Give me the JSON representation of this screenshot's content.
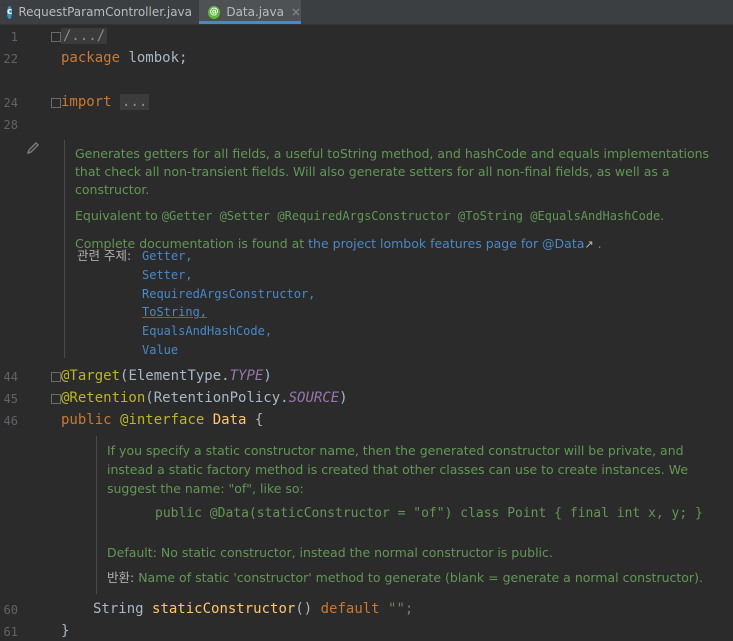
{
  "tabs": [
    {
      "label": "RequestParamController.java",
      "icon": "class-icon",
      "color": "#3592c4"
    },
    {
      "label": "Data.java",
      "icon": "annotation-icon",
      "color": "#62b543"
    }
  ],
  "close_glyph": "×",
  "gutter": {
    "l1": "1",
    "l22": "22",
    "l24": "24",
    "l28": "28",
    "l44": "44",
    "l45": "45",
    "l46": "46",
    "l60": "60",
    "l61": "61"
  },
  "code": {
    "collapsed_header": "/.../",
    "package_kw": "package",
    "package_name": " lombok;",
    "import_kw": "import",
    "import_dots": "...",
    "target_ann": "@Target",
    "target_open": "(ElementType.",
    "target_const": "TYPE",
    "target_close": ")",
    "retention_ann": "@Retention",
    "retention_open": "(RetentionPolicy.",
    "retention_const": "SOURCE",
    "retention_close": ")",
    "public_kw": "public",
    "interface_kw": "@interface",
    "data_name": "Data",
    "brace_open": " {",
    "string_type": "String ",
    "method_name": "staticConstructor",
    "method_parens": "() ",
    "default_kw": "default",
    "default_val": " \"\";",
    "brace_close": "}"
  },
  "doc1": {
    "para1": "Generates getters for all fields, a useful toString method, and hashCode and equals implementations that check all non-transient fields. Will also generate setters for all non-final fields, as well as a constructor.",
    "equivalent_prefix": "Equivalent to ",
    "equivalent_code": "@Getter @Setter @RequiredArgsConstructor @ToString @EqualsAndHashCode",
    "equivalent_suffix": ".",
    "complete_prefix": "Complete documentation is found at ",
    "complete_link": "the project lombok features page for @Data",
    "complete_suffix": " .",
    "external_glyph": "↗",
    "see_label": "관련 주제:",
    "see_items": [
      "Getter,",
      "Setter,",
      "RequiredArgsConstructor,",
      "ToString,",
      "EqualsAndHashCode,",
      "Value"
    ]
  },
  "doc2": {
    "para1": "If you specify a static constructor name, then the generated constructor will be private, and instead a static factory method is created that other classes can use to create instances. We suggest the name: \"of\", like so:",
    "example": "public @Data(staticConstructor = \"of\") class Point { final int x, y; }",
    "default_text": "Default: No static constructor, instead the normal constructor is public.",
    "return_label": "반환:",
    "return_text": " Name of static 'constructor' method to generate (blank = generate a normal constructor)."
  }
}
